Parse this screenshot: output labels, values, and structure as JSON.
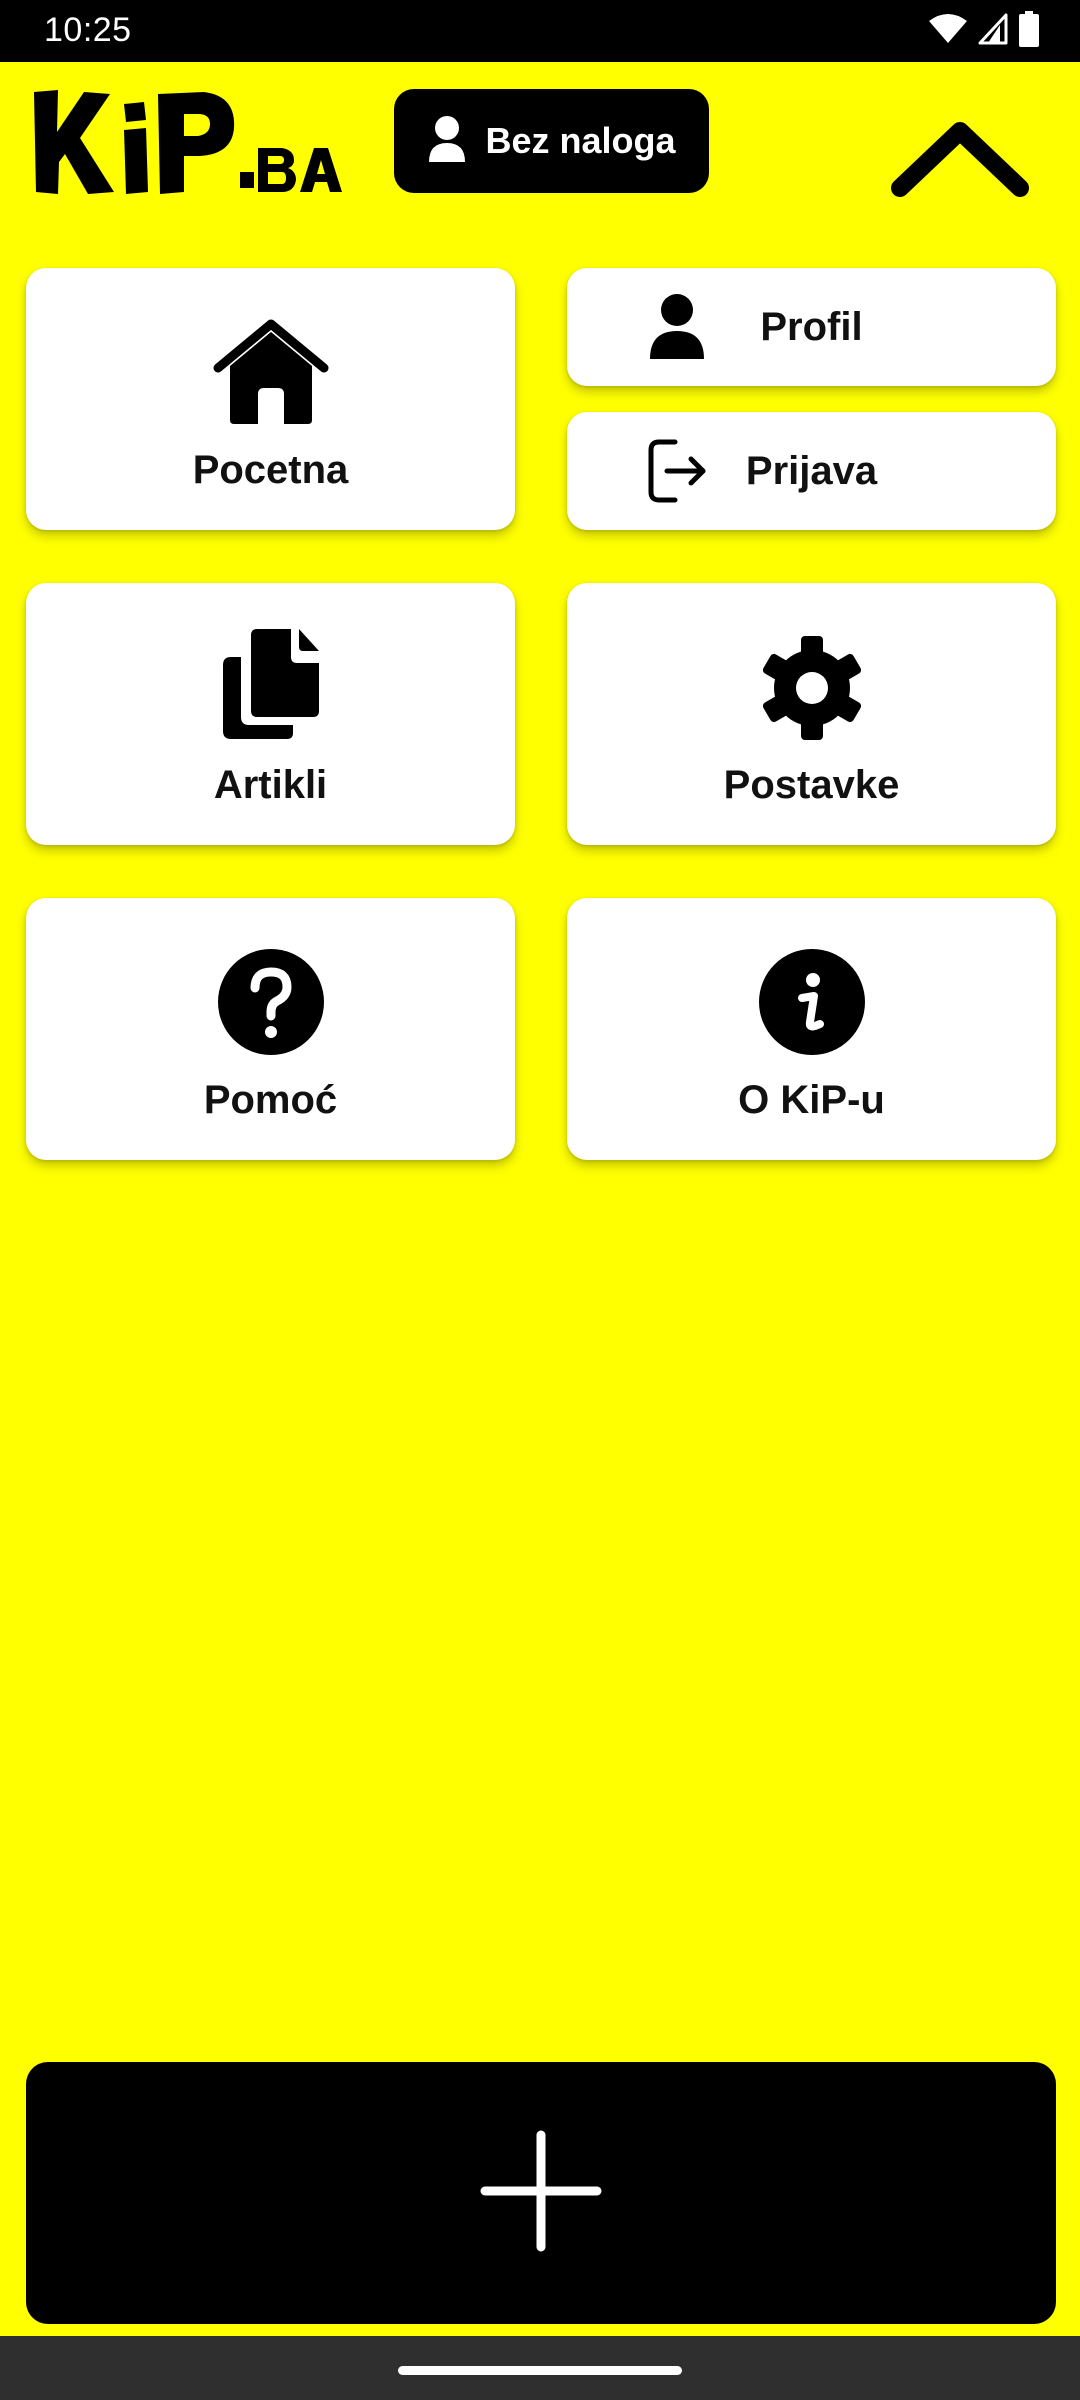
{
  "status_bar": {
    "time": "10:25",
    "icons": [
      "wifi-icon",
      "signal-icon",
      "battery-icon"
    ]
  },
  "header": {
    "logo_text": "KiP.BA",
    "account_button": {
      "label": "Bez naloga",
      "icon": "user-icon"
    },
    "collapse_icon": "chevron-up-icon"
  },
  "menu": {
    "home": {
      "label": "Pocetna",
      "icon": "home-icon"
    },
    "profile": {
      "label": "Profil",
      "icon": "user-icon"
    },
    "login": {
      "label": "Prijava",
      "icon": "sign-in-icon"
    },
    "articles": {
      "label": "Artikli",
      "icon": "documents-icon"
    },
    "settings": {
      "label": "Postavke",
      "icon": "gear-icon"
    },
    "help": {
      "label": "Pomoć",
      "icon": "question-circle-icon"
    },
    "about": {
      "label": "O KiP-u",
      "icon": "info-circle-icon"
    }
  },
  "add_button": {
    "icon": "plus-icon"
  },
  "colors": {
    "background": "#ffff00",
    "card": "#ffffff",
    "accent": "#000000"
  }
}
